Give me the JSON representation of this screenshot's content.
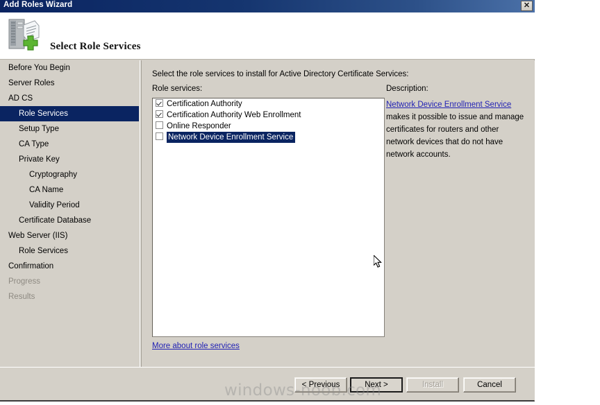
{
  "window": {
    "title": "Add Roles Wizard",
    "close_label": "✕",
    "close_icon": "close-icon"
  },
  "header": {
    "title": "Select Role Services",
    "icon": "server-add-icon"
  },
  "sidebar": {
    "items": [
      {
        "label": "Before You Begin",
        "level": 0,
        "state": "normal"
      },
      {
        "label": "Server Roles",
        "level": 0,
        "state": "normal"
      },
      {
        "label": "AD CS",
        "level": 0,
        "state": "normal"
      },
      {
        "label": "Role Services",
        "level": 1,
        "state": "selected"
      },
      {
        "label": "Setup Type",
        "level": 1,
        "state": "normal"
      },
      {
        "label": "CA Type",
        "level": 1,
        "state": "normal"
      },
      {
        "label": "Private Key",
        "level": 1,
        "state": "normal"
      },
      {
        "label": "Cryptography",
        "level": 2,
        "state": "normal"
      },
      {
        "label": "CA Name",
        "level": 2,
        "state": "normal"
      },
      {
        "label": "Validity Period",
        "level": 2,
        "state": "normal"
      },
      {
        "label": "Certificate Database",
        "level": 1,
        "state": "normal"
      },
      {
        "label": "Web Server (IIS)",
        "level": 0,
        "state": "normal"
      },
      {
        "label": "Role Services",
        "level": 1,
        "state": "normal"
      },
      {
        "label": "Confirmation",
        "level": 0,
        "state": "normal"
      },
      {
        "label": "Progress",
        "level": 0,
        "state": "dim"
      },
      {
        "label": "Results",
        "level": 0,
        "state": "dim"
      }
    ],
    "selected_color": "#0a2461"
  },
  "main": {
    "instruction": "Select the role services to install for Active Directory Certificate Services:",
    "roles_label": "Role services:",
    "description_label": "Description:",
    "role_services": [
      {
        "label": "Certification Authority",
        "checked": true,
        "selected": false
      },
      {
        "label": "Certification Authority Web Enrollment",
        "checked": true,
        "selected": false
      },
      {
        "label": "Online Responder",
        "checked": false,
        "selected": false
      },
      {
        "label": "Network Device Enrollment Service",
        "checked": false,
        "selected": true
      }
    ],
    "more_link": "More about role services",
    "description": {
      "link_text": "Network Device Enrollment Service",
      "body": " makes it possible to issue and manage certificates for routers and other network devices that do not have network accounts.",
      "link_color": "#1f1fb4"
    }
  },
  "footer": {
    "previous_label": "< Previous",
    "next_label": "Next >",
    "install_label": "Install",
    "cancel_label": "Cancel"
  },
  "watermark": {
    "text": "windows-noob.com"
  }
}
